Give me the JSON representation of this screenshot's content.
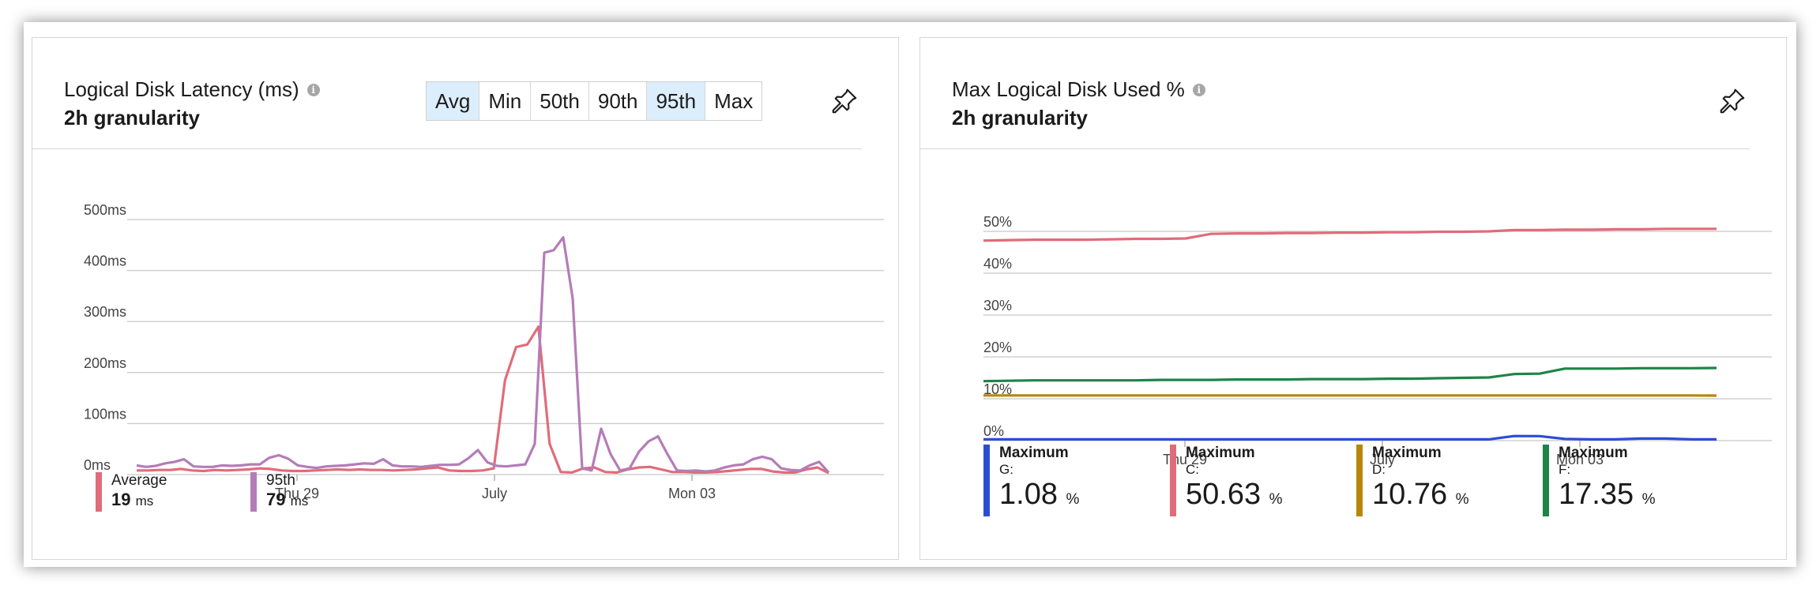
{
  "left_card": {
    "title": "Logical Disk Latency (ms)",
    "subtitle": "2h granularity",
    "aggregations": [
      {
        "label": "Avg",
        "active": true
      },
      {
        "label": "Min",
        "active": false
      },
      {
        "label": "50th",
        "active": false
      },
      {
        "label": "90th",
        "active": false
      },
      {
        "label": "95th",
        "active": true
      },
      {
        "label": "Max",
        "active": false
      }
    ],
    "legend": [
      {
        "label": "Average",
        "value": "19",
        "unit": "ms",
        "color": "#e06c7a"
      },
      {
        "label": "95th",
        "value": "79",
        "unit": "ms",
        "color": "#b57cb8"
      }
    ]
  },
  "right_card": {
    "title": "Max Logical Disk Used %",
    "subtitle": "2h granularity",
    "legend": [
      {
        "label": "Maximum",
        "sub": "G:",
        "value": "1.08",
        "unit": "%",
        "color": "#2b4dd6"
      },
      {
        "label": "Maximum",
        "sub": "C:",
        "value": "50.63",
        "unit": "%",
        "color": "#e06c7a"
      },
      {
        "label": "Maximum",
        "sub": "D:",
        "value": "10.76",
        "unit": "%",
        "color": "#b8860b"
      },
      {
        "label": "Maximum",
        "sub": "F:",
        "value": "17.35",
        "unit": "%",
        "color": "#1e8449"
      }
    ]
  },
  "chart_data": [
    {
      "type": "line",
      "title": "Logical Disk Latency (ms)",
      "ylim": [
        0,
        500
      ],
      "y_ticks": [
        "0ms",
        "100ms",
        "200ms",
        "300ms",
        "400ms",
        "500ms"
      ],
      "x_tick_labels": [
        "Thu 29",
        "July",
        "Mon 03"
      ],
      "grid": true,
      "legend": "bottom-left",
      "series": [
        {
          "name": "Average",
          "color": "#e06c7a",
          "values": [
            8,
            8,
            9,
            9,
            11,
            8,
            7,
            9,
            8,
            9,
            10,
            12,
            11,
            8,
            7,
            7,
            8,
            9,
            10,
            9,
            10,
            9,
            9,
            8,
            9,
            10,
            12,
            14,
            8,
            7,
            7,
            8,
            12,
            185,
            250,
            255,
            290,
            60,
            5,
            4,
            12,
            14,
            5,
            4,
            10,
            14,
            15,
            10,
            5,
            5,
            4,
            4,
            5,
            7,
            9,
            11,
            11,
            6,
            4,
            4,
            10,
            14,
            3
          ]
        },
        {
          "name": "95th",
          "color": "#b57cb8",
          "values": [
            18,
            15,
            17,
            22,
            25,
            30,
            16,
            15,
            15,
            18,
            17,
            18,
            20,
            20,
            33,
            38,
            31,
            18,
            15,
            13,
            16,
            17,
            18,
            20,
            22,
            21,
            30,
            18,
            16,
            16,
            15,
            17,
            19,
            19,
            20,
            32,
            48,
            24,
            17,
            16,
            18,
            20,
            60,
            435,
            440,
            465,
            345,
            12,
            8,
            90,
            40,
            8,
            12,
            45,
            65,
            75,
            40,
            8,
            7,
            8,
            6,
            8,
            14,
            18,
            20,
            30,
            35,
            30,
            12,
            9,
            8,
            18,
            25,
            4
          ]
        }
      ]
    },
    {
      "type": "line",
      "title": "Max Logical Disk Used %",
      "ylim": [
        0,
        50
      ],
      "y_ticks": [
        "0%",
        "10%",
        "20%",
        "30%",
        "40%",
        "50%"
      ],
      "x_tick_labels": [
        "Thu 29",
        "July",
        "Mon 03"
      ],
      "grid": true,
      "legend": "bottom-left",
      "series": [
        {
          "name": "C:",
          "color": "#e06c7a",
          "values": [
            47.8,
            47.9,
            48.0,
            48.0,
            48.0,
            48.1,
            48.2,
            48.2,
            48.3,
            49.4,
            49.5,
            49.5,
            49.6,
            49.6,
            49.7,
            49.7,
            49.8,
            49.8,
            49.9,
            49.9,
            50.0,
            50.3,
            50.3,
            50.4,
            50.4,
            50.5,
            50.5,
            50.6,
            50.6,
            50.6
          ]
        },
        {
          "name": "F:",
          "color": "#1e8449",
          "values": [
            14.2,
            14.3,
            14.4,
            14.4,
            14.4,
            14.4,
            14.4,
            14.5,
            14.5,
            14.5,
            14.6,
            14.6,
            14.6,
            14.7,
            14.7,
            14.7,
            14.8,
            14.8,
            14.9,
            15.0,
            15.1,
            15.9,
            16.0,
            17.2,
            17.2,
            17.2,
            17.3,
            17.3,
            17.3,
            17.35
          ]
        },
        {
          "name": "D:",
          "color": "#b8860b",
          "values": [
            10.8,
            10.8,
            10.8,
            10.8,
            10.8,
            10.8,
            10.8,
            10.8,
            10.8,
            10.8,
            10.8,
            10.8,
            10.8,
            10.8,
            10.8,
            10.8,
            10.8,
            10.8,
            10.8,
            10.8,
            10.8,
            10.8,
            10.8,
            10.8,
            10.8,
            10.8,
            10.8,
            10.8,
            10.8,
            10.76
          ]
        },
        {
          "name": "G:",
          "color": "#2b4dd6",
          "values": [
            0.3,
            0.3,
            0.3,
            0.3,
            0.3,
            0.3,
            0.3,
            0.3,
            0.3,
            0.3,
            0.3,
            0.3,
            0.3,
            0.3,
            0.3,
            0.3,
            0.3,
            0.3,
            0.3,
            0.3,
            0.3,
            1.1,
            1.08,
            0.4,
            0.3,
            0.3,
            0.5,
            0.5,
            0.3,
            0.3
          ]
        }
      ]
    }
  ]
}
